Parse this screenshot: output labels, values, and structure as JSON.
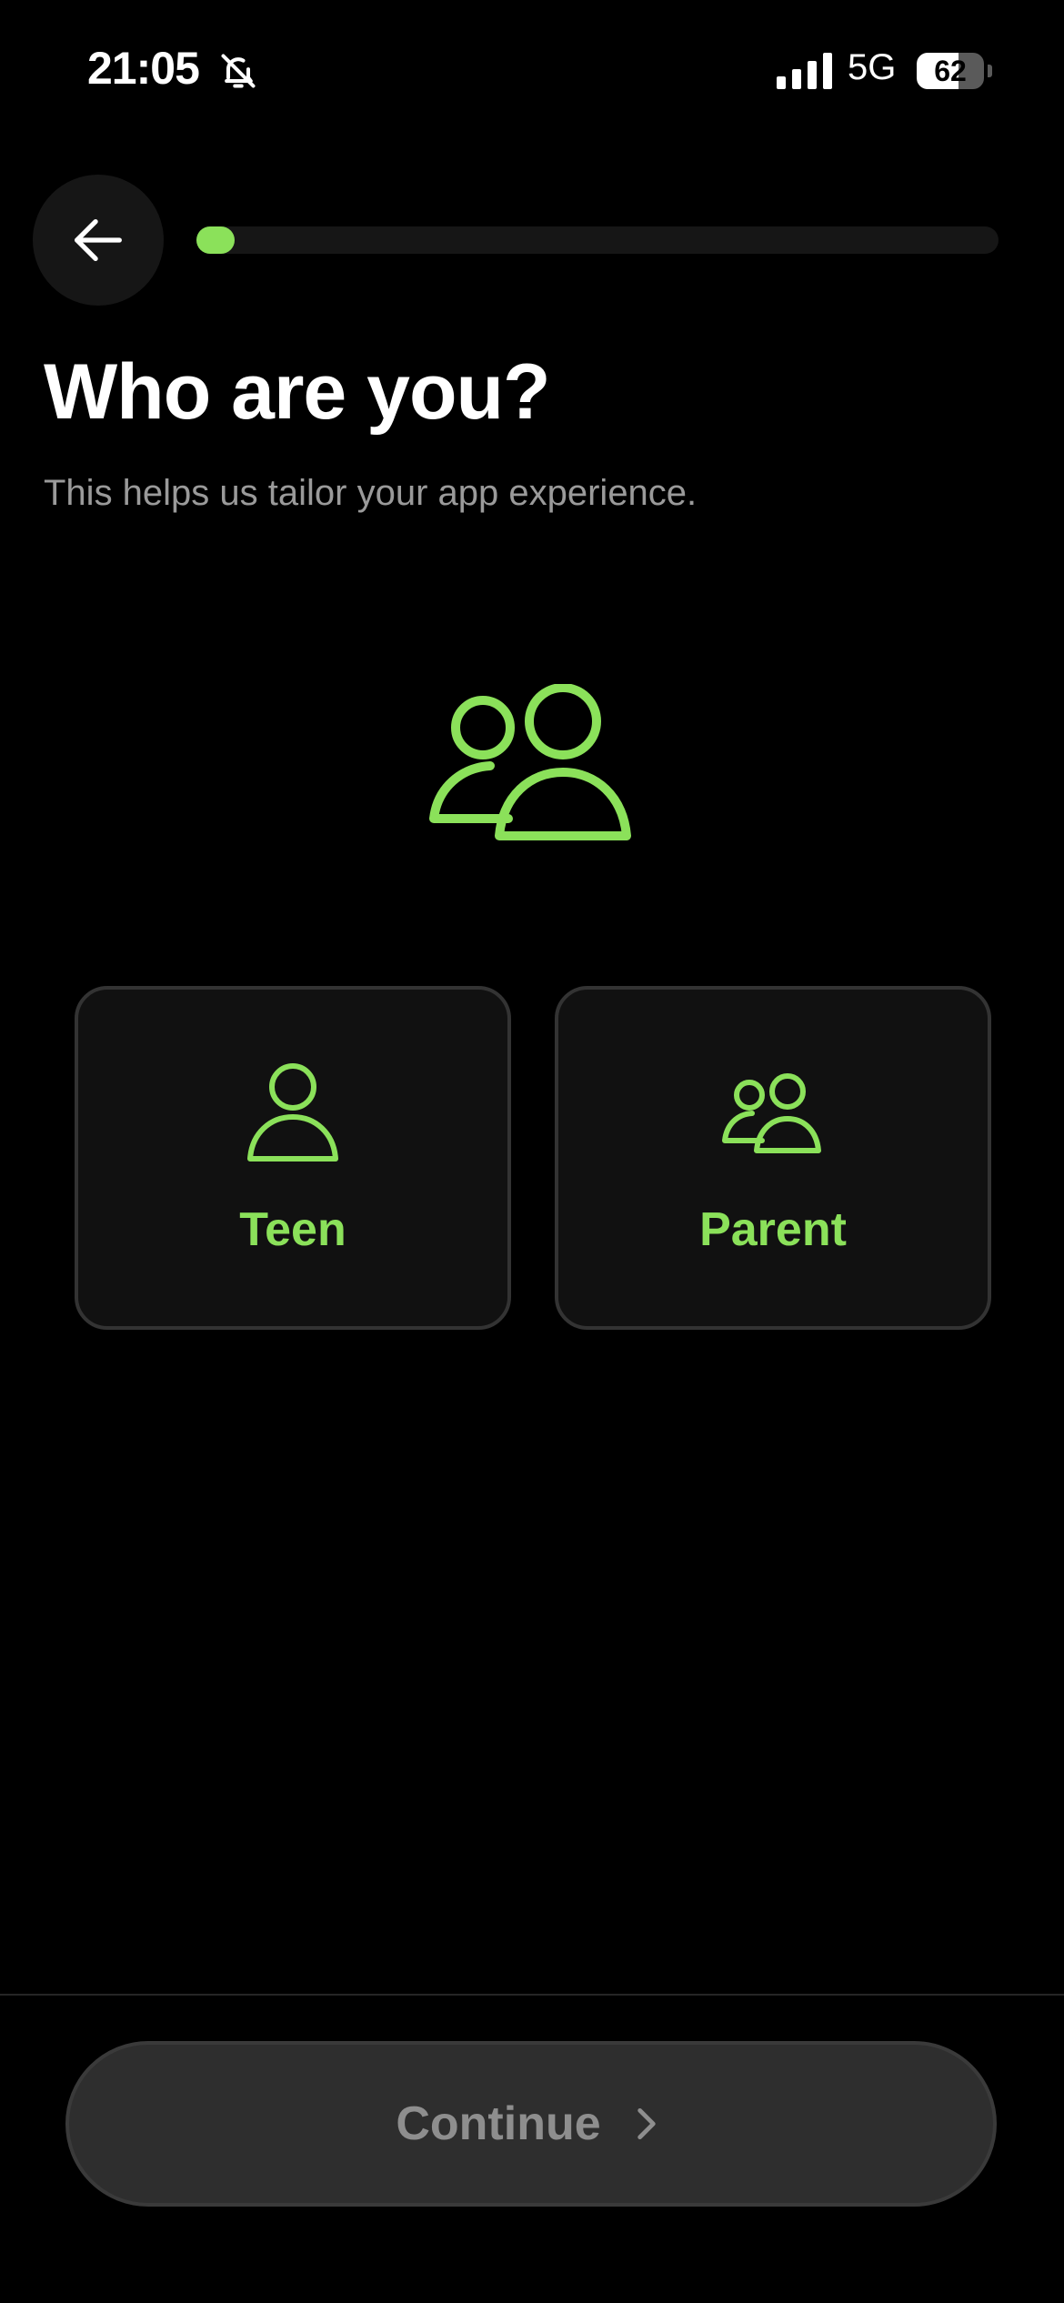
{
  "status_bar": {
    "time": "21:05",
    "network": "5G",
    "battery_level": "62",
    "battery_fraction": 0.62
  },
  "navigation": {
    "back_icon": "arrow-left-icon",
    "progress_fraction": 0.04
  },
  "header": {
    "title": "Who are you?",
    "subtitle": "This helps us tailor your app experience."
  },
  "hero": {
    "icon": "users-icon"
  },
  "roles": [
    {
      "label": "Teen",
      "icon": "user-icon"
    },
    {
      "label": "Parent",
      "icon": "users-icon"
    }
  ],
  "footer": {
    "continue_label": "Continue",
    "continue_icon": "chevron-right-icon"
  },
  "colors": {
    "accent": "#8be15a",
    "background": "#000000",
    "card_background": "#111111",
    "card_border": "#333333",
    "muted_text": "#9a9a9a",
    "button_background": "#2e2e2e"
  }
}
